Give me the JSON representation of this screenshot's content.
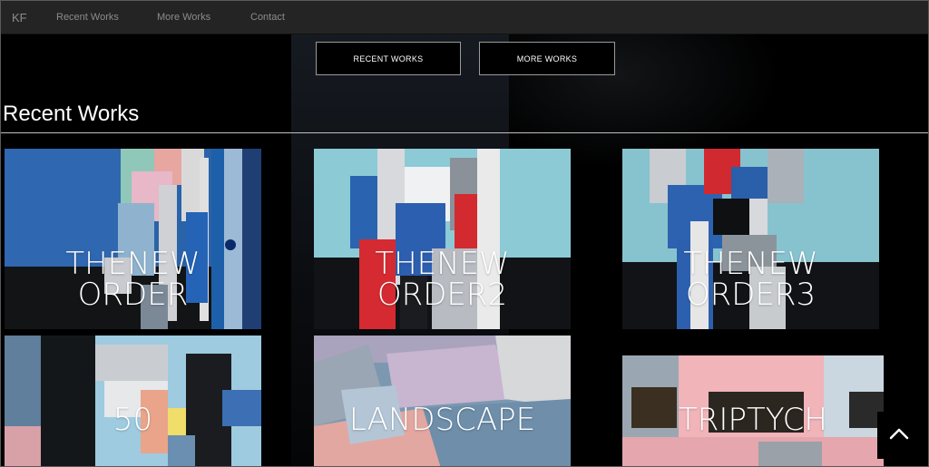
{
  "nav": {
    "brand": "KF",
    "links": [
      "Recent Works",
      "More Works",
      "Contact"
    ]
  },
  "buttons": {
    "recent": "RECENT WORKS",
    "more": "MORE WORKS"
  },
  "section": {
    "title": "Recent Works"
  },
  "works": [
    {
      "line1": "THENEW",
      "line2": "ORDER"
    },
    {
      "line1": "THENEW",
      "line2": "ORDER2"
    },
    {
      "line1": "THENEW",
      "line2": "ORDER3"
    },
    {
      "line1": "50"
    },
    {
      "line1": "LANDSCAPE"
    },
    {
      "line1": "TRIPTYCH"
    }
  ],
  "icons": {
    "back_to_top": "chevron-up-icon"
  },
  "colors": {
    "page_bg": "#000000",
    "navbar_bg": "#242424",
    "nav_text": "#8c8c8c",
    "button_border": "#9a9a9a"
  }
}
